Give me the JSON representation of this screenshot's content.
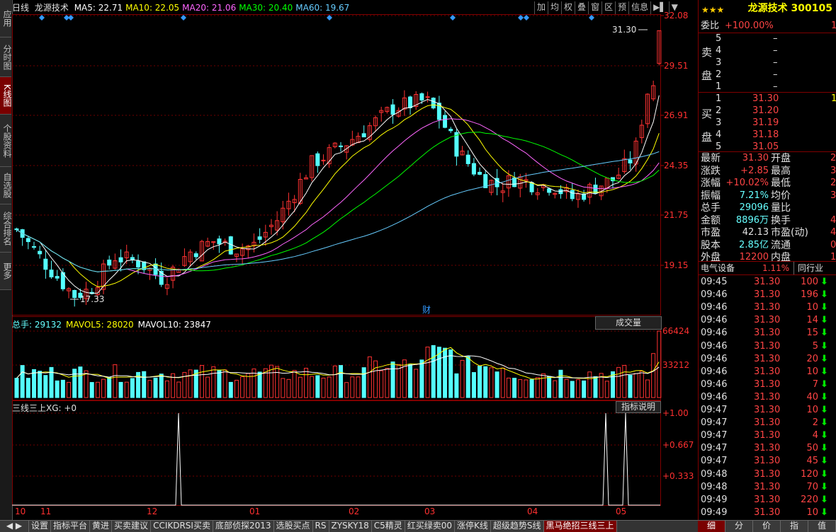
{
  "left_tabs": [
    "应用",
    "分时图",
    "K线图",
    "个股资料",
    "自选股",
    "综合排名",
    "更多"
  ],
  "header": {
    "period": "日线",
    "name": "龙源技术",
    "ma": [
      {
        "label": "MA5: 22.71",
        "color": "#ffffff"
      },
      {
        "label": "MA10: 22.05",
        "color": "#ffff00"
      },
      {
        "label": "MA20: 21.06",
        "color": "#ff66ff"
      },
      {
        "label": "MA30: 20.40",
        "color": "#00ff00"
      },
      {
        "label": "MA60: 19.67",
        "color": "#66ccff"
      }
    ]
  },
  "toolbar": [
    "加",
    "均",
    "权",
    "叠",
    "窗",
    "区",
    "预",
    "信息",
    "▶▌",
    "▼"
  ],
  "price_axis": [
    "32.08",
    "29.51",
    "26.91",
    "24.35",
    "21.75",
    "19.15"
  ],
  "annotations": {
    "high": "31.30",
    "low": "17.33",
    "cai": "财"
  },
  "volume_panel": {
    "header": [
      {
        "label": "总手: 29132",
        "color": "#66ffff"
      },
      {
        "label": "MAVOL5: 28020",
        "color": "#ffff00"
      },
      {
        "label": "MAVOL10: 23847",
        "color": "#ffffff"
      }
    ],
    "selector": "成交量",
    "axis": [
      "66424",
      "33212"
    ]
  },
  "indicator_panel": {
    "header": "三线三上XG: +0",
    "button": "指标说明",
    "axis": [
      "+1.00",
      "+0.667",
      "+0.333"
    ]
  },
  "date_axis": [
    "10",
    "11",
    "12",
    "01",
    "02",
    "03",
    "04",
    "05"
  ],
  "right_panel": {
    "title": "龙源技术 300105",
    "weibi_label": "委比",
    "weibi_value": "+100.00%",
    "weibi_extra": "1",
    "sell_side": "卖盘",
    "sell": [
      {
        "n": "5",
        "p": "–"
      },
      {
        "n": "4",
        "p": "–"
      },
      {
        "n": "3",
        "p": "–"
      },
      {
        "n": "2",
        "p": "–"
      },
      {
        "n": "1",
        "p": "–"
      }
    ],
    "buy_side": "买盘",
    "buy": [
      {
        "n": "1",
        "p": "31.30",
        "v": "1"
      },
      {
        "n": "2",
        "p": "31.20",
        "v": ""
      },
      {
        "n": "3",
        "p": "31.19",
        "v": ""
      },
      {
        "n": "4",
        "p": "31.18",
        "v": ""
      },
      {
        "n": "5",
        "p": "31.05",
        "v": ""
      }
    ],
    "stats": [
      {
        "l1": "最新",
        "v1": "31.30",
        "c1": "red",
        "l2": "开盘",
        "v2": "2"
      },
      {
        "l1": "涨跌",
        "v1": "+2.85",
        "c1": "red",
        "l2": "最高",
        "v2": "3"
      },
      {
        "l1": "涨幅",
        "v1": "+10.02%",
        "c1": "red",
        "l2": "最低",
        "v2": "2"
      },
      {
        "l1": "振幅",
        "v1": "7.21%",
        "c1": "cyan",
        "l2": "均价",
        "v2": "3"
      },
      {
        "l1": "总手",
        "v1": "29096",
        "c1": "cyan",
        "l2": "量比",
        "v2": ""
      },
      {
        "l1": "金额",
        "v1": "8896万",
        "c1": "cyan",
        "l2": "换手",
        "v2": "4"
      },
      {
        "l1": "市盈",
        "v1": "42.13",
        "c1": "white",
        "l2": "市盈(动)",
        "v2": "4"
      },
      {
        "l1": "股本",
        "v1": "2.85亿",
        "c1": "cyan",
        "l2": "流通",
        "v2": "0."
      },
      {
        "l1": "外盘",
        "v1": "12200",
        "c1": "red",
        "l2": "内盘",
        "v2": "1"
      }
    ],
    "sector": "电气设备",
    "sector_pct": "1.11%",
    "sector_btn": "同行业",
    "ticks": [
      {
        "t": "09:45",
        "p": "31.30",
        "v": "100"
      },
      {
        "t": "09:46",
        "p": "31.30",
        "v": "196"
      },
      {
        "t": "09:46",
        "p": "31.30",
        "v": "10"
      },
      {
        "t": "09:46",
        "p": "31.30",
        "v": "14"
      },
      {
        "t": "09:46",
        "p": "31.30",
        "v": "15"
      },
      {
        "t": "09:46",
        "p": "31.30",
        "v": "5"
      },
      {
        "t": "09:46",
        "p": "31.30",
        "v": "20"
      },
      {
        "t": "09:46",
        "p": "31.30",
        "v": "10"
      },
      {
        "t": "09:46",
        "p": "31.30",
        "v": "7"
      },
      {
        "t": "09:46",
        "p": "31.30",
        "v": "40"
      },
      {
        "t": "09:47",
        "p": "31.30",
        "v": "10"
      },
      {
        "t": "09:47",
        "p": "31.30",
        "v": "2"
      },
      {
        "t": "09:47",
        "p": "31.30",
        "v": "4"
      },
      {
        "t": "09:47",
        "p": "31.30",
        "v": "50"
      },
      {
        "t": "09:47",
        "p": "31.30",
        "v": "45"
      },
      {
        "t": "09:48",
        "p": "31.30",
        "v": "120"
      },
      {
        "t": "09:48",
        "p": "31.30",
        "v": "70"
      },
      {
        "t": "09:49",
        "p": "31.30",
        "v": "220"
      },
      {
        "t": "09:49",
        "p": "31.30",
        "v": "10"
      }
    ],
    "bottom_tabs": [
      "细",
      "分",
      "价",
      "指",
      "值"
    ]
  },
  "bottom_tabs": [
    "设置",
    "指标平台",
    "黄进",
    "买卖建议",
    "CCIKDRSI买卖",
    "底部侦探2013",
    "选股买点",
    "RS",
    "ZYSKY18",
    "C5精灵",
    "红买绿卖00",
    "涨停K线",
    "超级趋势S线",
    "黑马绝招三线三上"
  ],
  "chart_data": {
    "type": "candlestick",
    "price_range": [
      17.33,
      31.3
    ],
    "ma_legend": [
      "MA5",
      "MA10",
      "MA20",
      "MA30",
      "MA60"
    ],
    "volume_range": [
      0,
      66424
    ],
    "indicator_signal_levels": [
      0,
      1
    ]
  }
}
